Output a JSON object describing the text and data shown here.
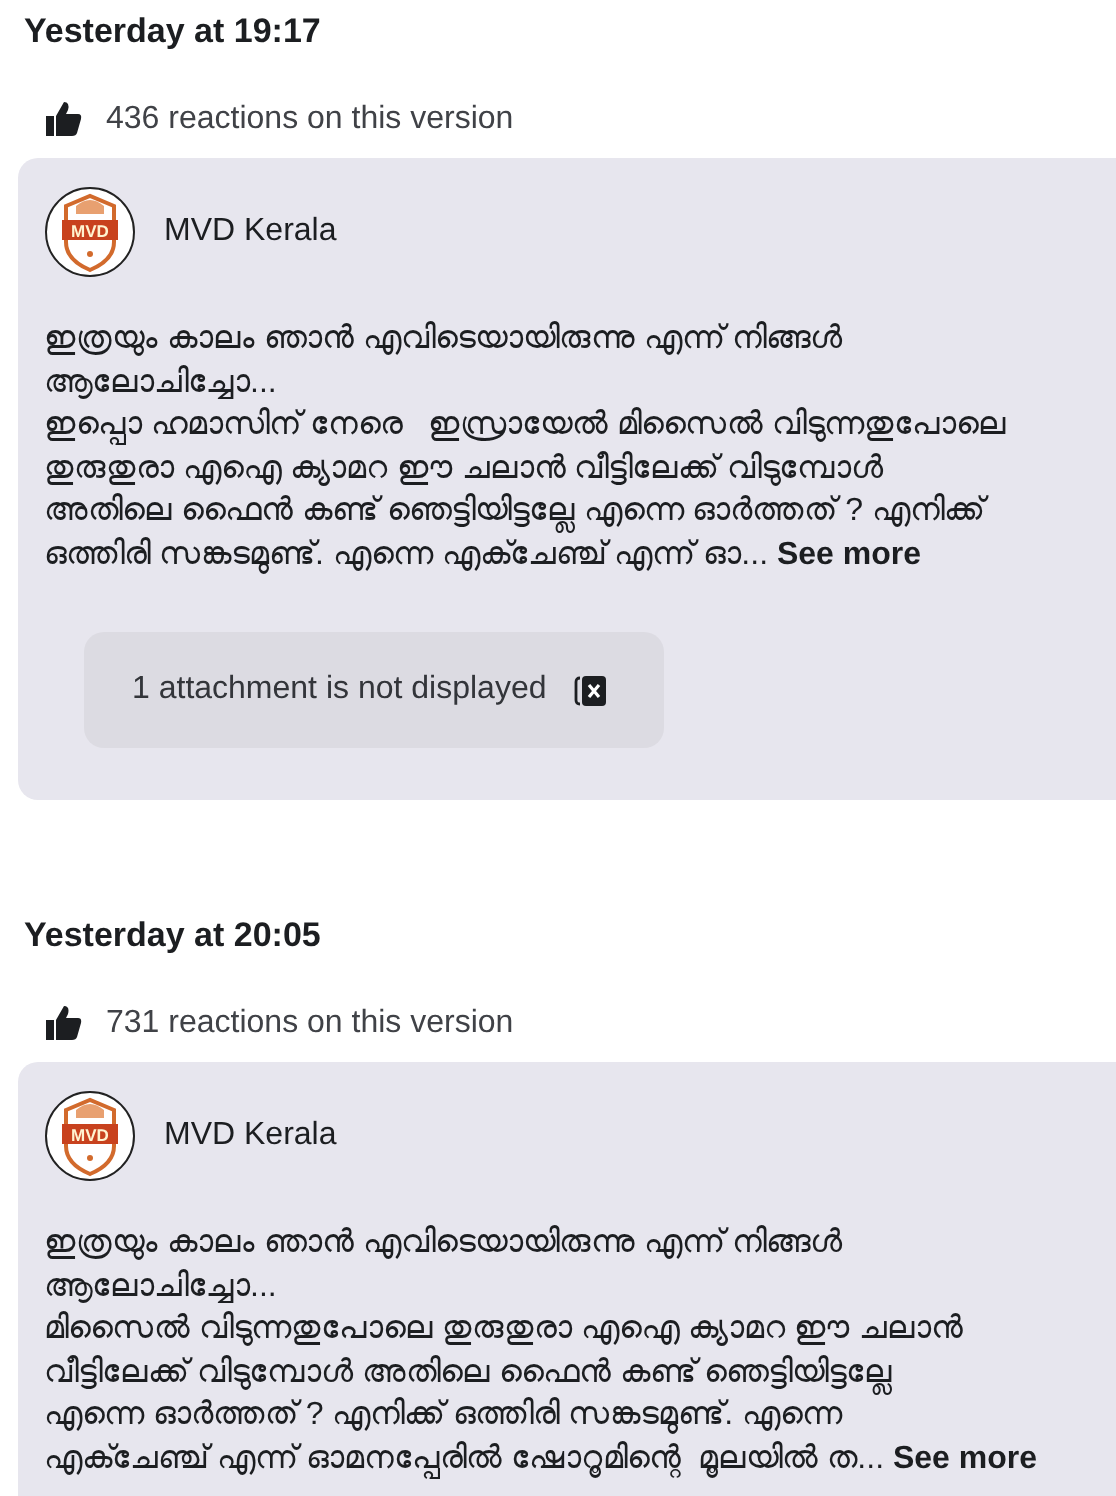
{
  "versions": [
    {
      "timestamp": "Yesterday at 19:17",
      "reactions": "436 reactions on this version",
      "post": {
        "author": "MVD Kerala",
        "logo_text": "MVD",
        "lines": [
          "ഇത്രയും കാലം ഞാൻ എവിടെയായിരുന്നു എന്ന് നിങ്ങൾ",
          "ആലോചിച്ചോ...",
          "ഇപ്പൊ ഹമാസിന് നേരെ   ഇസ്രായേൽ മിസൈൽ വിടുന്നതുപോലെ",
          "തുരുതുരാ എഐ ക്യാമറ ഈ ചലാൻ വീട്ടിലേക്ക് വിടുമ്പോൾ",
          "അതിലെ ഫൈൻ കണ്ട് ഞെട്ടിയിട്ടല്ലേ എന്നെ ഓർത്തത് ? എനിക്ക്",
          "ഒത്തിരി സങ്കടമുണ്ട്. എന്നെ എക്ചേഞ്ച് എന്ന് ഓ..."
        ],
        "see_more": "See more",
        "attachment": "1 attachment is not displayed"
      }
    },
    {
      "timestamp": "Yesterday at 20:05",
      "reactions": "731 reactions on this version",
      "post": {
        "author": "MVD Kerala",
        "logo_text": "MVD",
        "lines": [
          "ഇത്രയും കാലം ഞാൻ എവിടെയായിരുന്നു എന്ന് നിങ്ങൾ",
          "ആലോചിച്ചോ...",
          "മിസൈൽ വിടുന്നതുപോലെ തുരുതുരാ എഐ ക്യാമറ ഈ ചലാൻ",
          "വീട്ടിലേക്ക് വിടുമ്പോൾ അതിലെ ഫൈൻ കണ്ട് ഞെട്ടിയിട്ടല്ലേ",
          "എന്നെ ഓർത്തത് ? എനിക്ക് ഒത്തിരി സങ്കടമുണ്ട്. എന്നെ",
          "എക്ചേഞ്ച് എന്ന് ഓമനപ്പേരിൽ ഷോറൂമിന്റെ  മൂലയിൽ ത..."
        ],
        "see_more": "See more"
      }
    }
  ]
}
